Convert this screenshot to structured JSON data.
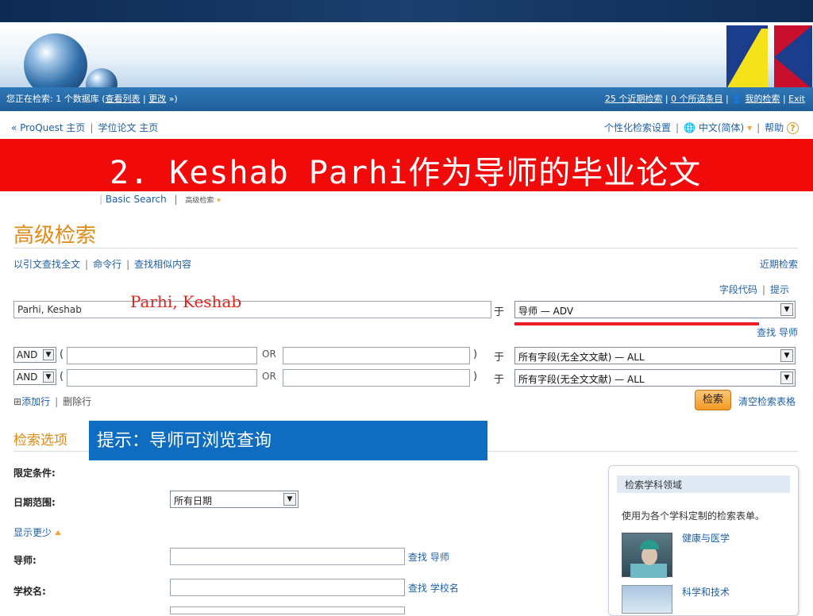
{
  "header": {
    "status_prefix": "您正在检索: 1 个数据库 (",
    "view_list_link": "查看列表",
    "change_link": "更改",
    "status_suffix": " »)",
    "recent_searches_link": "25 个近期检索",
    "selected_items_link": "0 个所选条目",
    "my_search_link": "我的检索",
    "exit_link": "Exit"
  },
  "nav": {
    "proquest_home": "« ProQuest 主页",
    "dissertations_home": "学位论文 主页",
    "personal_settings": "个性化检索设置",
    "language": "中文(简体)",
    "help": "帮助"
  },
  "overlay_banner": {
    "title": "2. Keshab Parhi作为导师的毕业论文"
  },
  "search_tabs": {
    "basic": "Basic Search",
    "advanced": "高级检索"
  },
  "page": {
    "title": "高级检索",
    "links": [
      "以引文查找全文",
      "命令行",
      "查找相似内容"
    ],
    "recent": "近期检索",
    "field_codes": "字段代码",
    "tips": "提示"
  },
  "query": {
    "row1_value": "Parhi, Keshab",
    "row1_annotation": "Parhi, Keshab",
    "in_label": "于",
    "row1_field": "导师 — ADV",
    "find_advisor": "查找 导师",
    "bool1": "AND",
    "bool2": "AND",
    "or_label": "OR",
    "open_paren": "(",
    "close_paren": ")",
    "row2_field": "所有字段(无全文文献) — ALL",
    "row3_field": "所有字段(无全文文献) — ALL",
    "add_row": "添加行",
    "remove_row": "删除行",
    "search_button": "检索",
    "clear_form": "清空检索表格"
  },
  "options": {
    "title": "检索选项",
    "tip_overlay": "提示：导师可浏览查询",
    "limits_label": "限定条件:",
    "date_range_label": "日期范围:",
    "date_value": "所有日期",
    "show_less": "显示更少",
    "advisor_label": "导师:",
    "advisor_find": "查找 导师",
    "school_label": "学校名:",
    "school_find": "查找 学校名"
  },
  "side_panel": {
    "header": "检索学科领域",
    "desc": "使用为各个学科定制的检索表单。",
    "items": [
      "健康与医学",
      "科学和技术"
    ]
  },
  "colors": {
    "accent_orange": "#e08a18",
    "link_blue": "#1e5fa8",
    "overlay_red": "#f00a0a",
    "tip_blue": "#0f6dc1"
  }
}
